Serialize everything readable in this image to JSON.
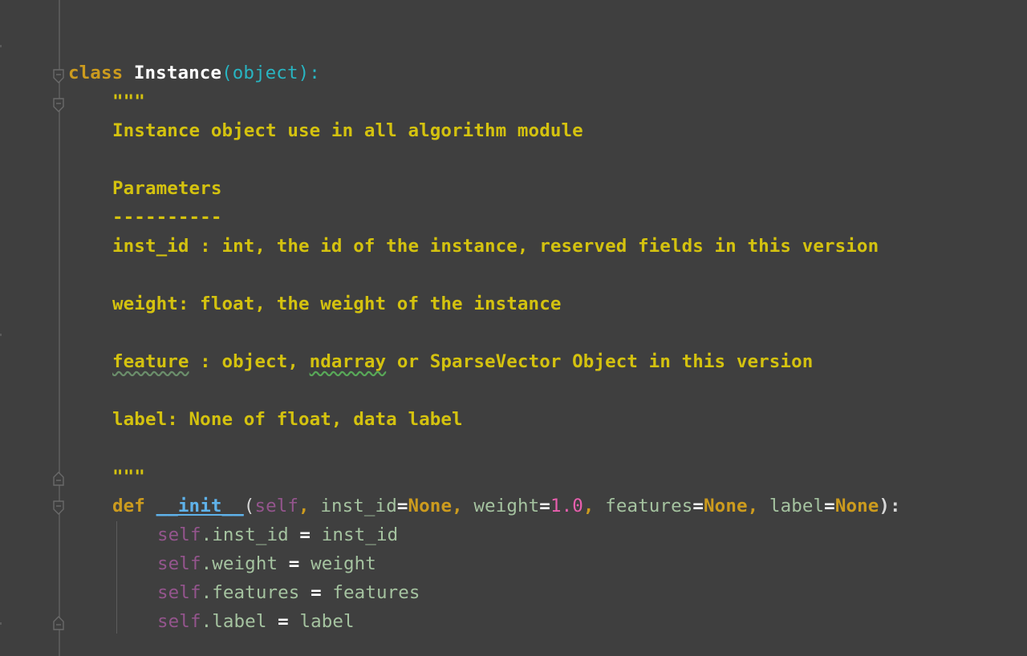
{
  "code": {
    "class_line": {
      "kw_class": "class",
      "class_name": "Instance",
      "paren_open": "(",
      "base": "object",
      "paren_close_colon": "):"
    },
    "doc_open": "\"\"\"",
    "doc_summary": "Instance object use in all algorithm module",
    "doc_params_header": "Parameters",
    "doc_params_rule": "----------",
    "doc_inst_id": "inst_id : int, the id of the instance, reserved fields in this version",
    "doc_weight": "weight: float, the weight of the instance",
    "doc_feature_word": "feature",
    "doc_feature_mid": " : object, ",
    "doc_feature_ndarray": "ndarray",
    "doc_feature_rest": " or SparseVector Object in this version",
    "doc_label": "label: None of float, data label",
    "doc_close": "\"\"\"",
    "def_line": {
      "kw_def": "def",
      "fn_name": "__init__",
      "paren_open": "(",
      "self": "self",
      "comma1": ", ",
      "p1": "inst_id",
      "eq1": "=",
      "v1": "None",
      "comma2": ", ",
      "p2": "weight",
      "eq2": "=",
      "v2": "1.0",
      "comma3": ", ",
      "p3": "features",
      "eq3": "=",
      "v3": "None",
      "comma4": ", ",
      "p4": "label",
      "eq4": "=",
      "v4": "None",
      "close": "):"
    },
    "body": [
      {
        "self": "self",
        "attr": ".inst_id",
        "eq": " = ",
        "rhs": "inst_id"
      },
      {
        "self": "self",
        "attr": ".weight",
        "eq": " = ",
        "rhs": "weight"
      },
      {
        "self": "self",
        "attr": ".features",
        "eq": " = ",
        "rhs": "features"
      },
      {
        "self": "self",
        "attr": ".label",
        "eq": " = ",
        "rhs": "label"
      }
    ]
  },
  "icons": {
    "fold_open": "fold-open-icon",
    "fold_close": "fold-close-icon"
  },
  "colors": {
    "background": "#3f3f3f",
    "keyword": "#cc9b1e",
    "docstring": "#d4c20f",
    "builtin": "#28b5c2",
    "self": "#94558d",
    "number": "#e85fae",
    "function": "#5fb2ea"
  }
}
